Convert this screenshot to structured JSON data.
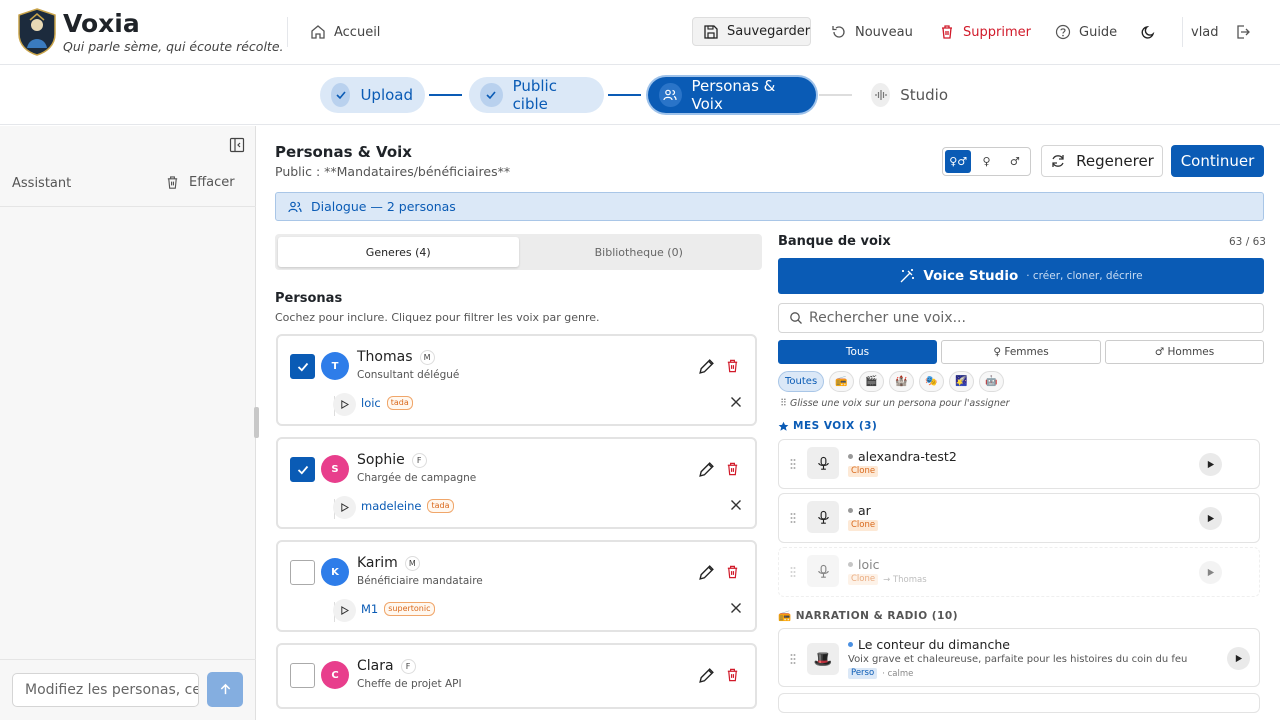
{
  "brand": {
    "name": "Voxia",
    "tagline": "Qui parle sème, qui écoute récolte."
  },
  "nav": {
    "home": "Accueil",
    "save": "Sauvegarder",
    "new": "Nouveau",
    "delete": "Supprimer",
    "guide": "Guide",
    "user": "vlad"
  },
  "steps": [
    {
      "label": "Upload",
      "state": "done"
    },
    {
      "label": "Public cible",
      "state": "done"
    },
    {
      "label": "Personas & Voix",
      "state": "active"
    },
    {
      "label": "Studio",
      "state": "pending"
    }
  ],
  "sidebar": {
    "title": "Assistant",
    "clear": "Effacer",
    "input_placeholder": "Modifiez les personas, ces voix..."
  },
  "main": {
    "title": "Personas & Voix",
    "subtitle": "Public : **Mandataires/bénéficiaires**",
    "gender_toggle": [
      "♀♂",
      "♀",
      "♂"
    ],
    "regenerate": "Regenerer",
    "continue": "Continuer",
    "dialogue": "Dialogue — 2 personas",
    "tabs": [
      "Generes (4)",
      "Bibliotheque (0)"
    ],
    "personas_title": "Personas",
    "personas_sub": "Cochez pour inclure. Cliquez pour filtrer les voix par genre."
  },
  "personas": [
    {
      "initial": "T",
      "name": "Thomas",
      "gender": "M",
      "role": "Consultant délégué",
      "voice": "loic",
      "engine": "tada",
      "checked": true,
      "color": "#2e7de9"
    },
    {
      "initial": "S",
      "name": "Sophie",
      "gender": "F",
      "role": "Chargée de campagne",
      "voice": "madeleine",
      "engine": "tada",
      "checked": true,
      "color": "#e83e8c"
    },
    {
      "initial": "K",
      "name": "Karim",
      "gender": "M",
      "role": "Bénéficiaire mandataire",
      "voice": "M1",
      "engine": "supertonic",
      "checked": false,
      "color": "#2e7de9"
    },
    {
      "initial": "C",
      "name": "Clara",
      "gender": "F",
      "role": "Cheffe de projet API",
      "voice": "",
      "engine": "",
      "checked": false,
      "color": "#e83e8c"
    }
  ],
  "bank": {
    "title": "Banque de voix",
    "count": "63 / 63",
    "studio_label": "Voice Studio",
    "studio_sub": "· créer, cloner, décrire",
    "search_placeholder": "Rechercher une voix...",
    "filters": [
      "Tous",
      "♀ Femmes",
      "♂ Hommes"
    ],
    "categories": [
      "Toutes",
      "📻",
      "🎬",
      "🏰",
      "🎭",
      "🌠",
      "🤖"
    ],
    "drag_hint": "Glisse une voix sur un persona pour l'assigner",
    "mine_title": "MES VOIX (3)",
    "mine": [
      {
        "name": "alexandra-test2",
        "tag": "Clone",
        "assigned": ""
      },
      {
        "name": "ar",
        "tag": "Clone",
        "assigned": ""
      },
      {
        "name": "loic",
        "tag": "Clone",
        "assigned": "→ Thomas"
      }
    ],
    "radio_title": "📻 NARRATION & RADIO (10)",
    "radio": [
      {
        "name": "Le conteur du dimanche",
        "desc": "Voix grave et chaleureuse, parfaite pour les histoires du coin du feu",
        "tag": "Perso",
        "mood": "· calme",
        "icon": "🎩"
      }
    ]
  },
  "colors": {
    "accent": "#0a5bb5",
    "danger": "#d11a2a"
  }
}
